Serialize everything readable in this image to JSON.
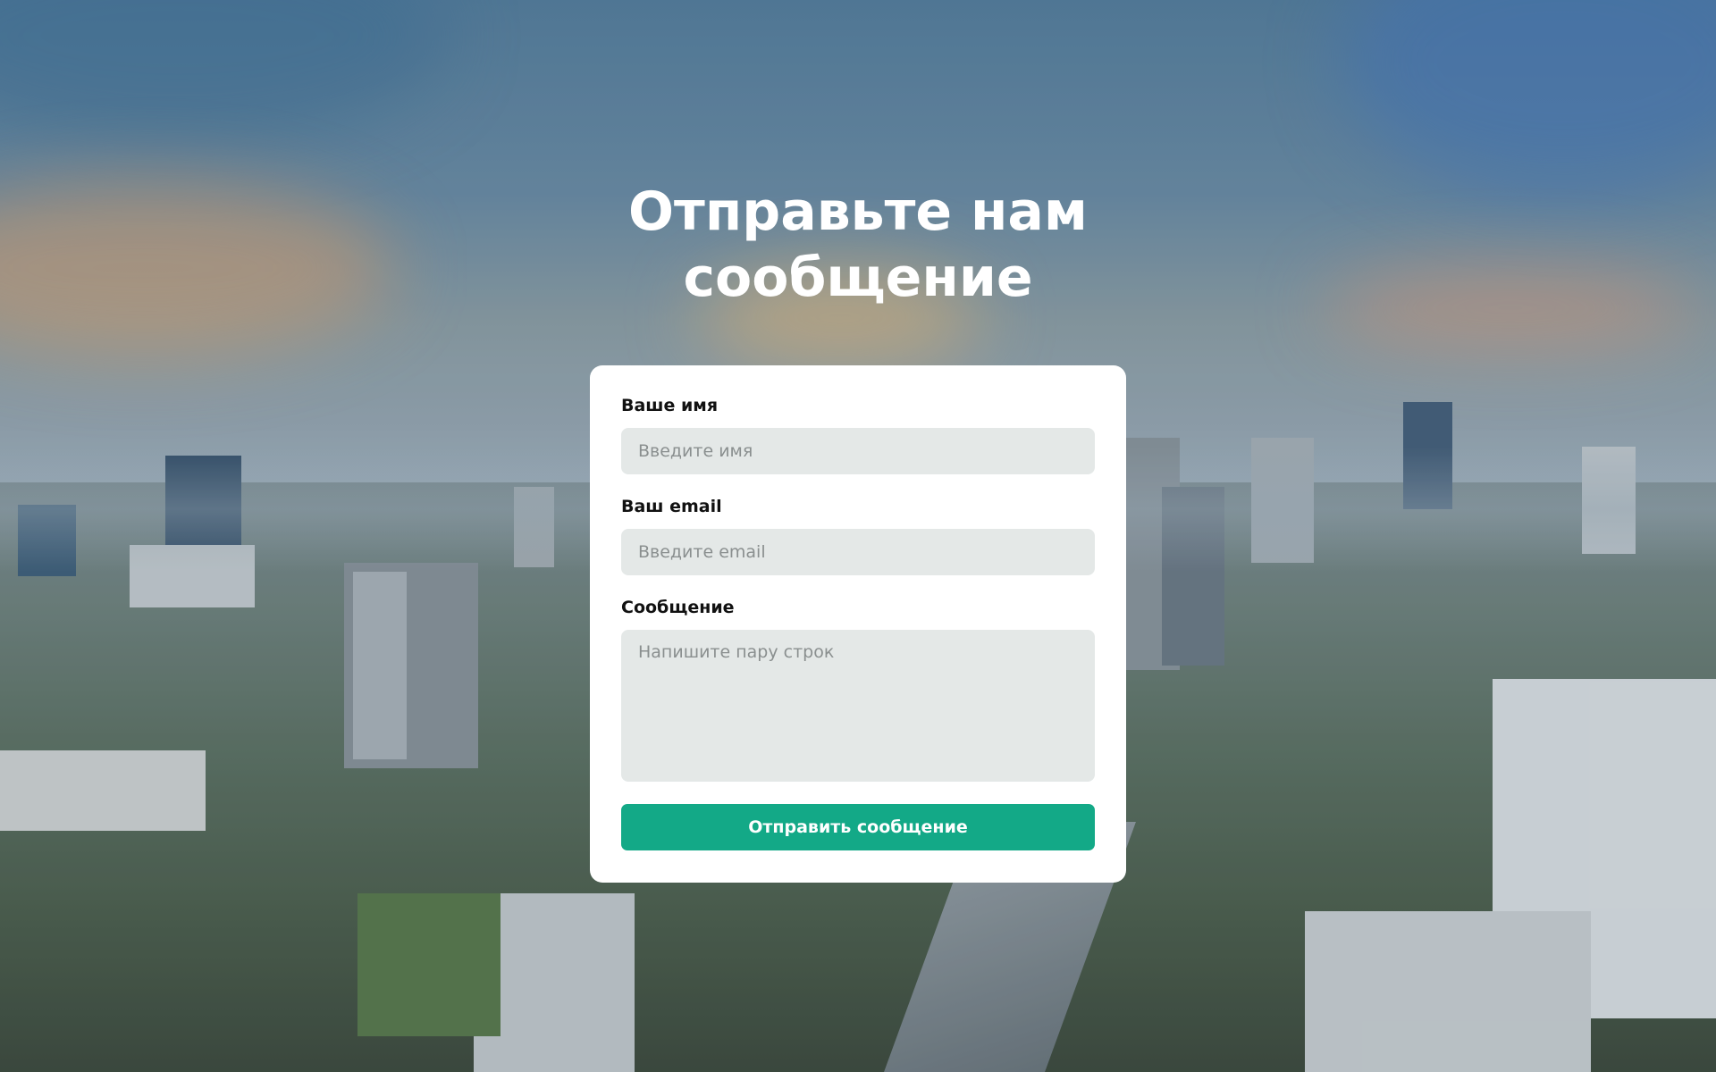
{
  "page": {
    "title": "Отправьте нам сообщение",
    "title_line1": "Отправьте нам",
    "title_line2": "сообщение"
  },
  "form": {
    "name": {
      "label": "Ваше имя",
      "placeholder": "Введите имя",
      "value": ""
    },
    "email": {
      "label": "Ваш email",
      "placeholder": "Введите email",
      "value": ""
    },
    "message": {
      "label": "Сообщение",
      "placeholder": "Напишите пару строк",
      "value": ""
    },
    "submit_label": "Отправить сообщение"
  },
  "colors": {
    "accent": "#13a987",
    "card_background": "#ffffff",
    "field_background": "#e4e8e7",
    "title_text": "#ffffff"
  },
  "background": {
    "type": "city-skyline-photo"
  }
}
